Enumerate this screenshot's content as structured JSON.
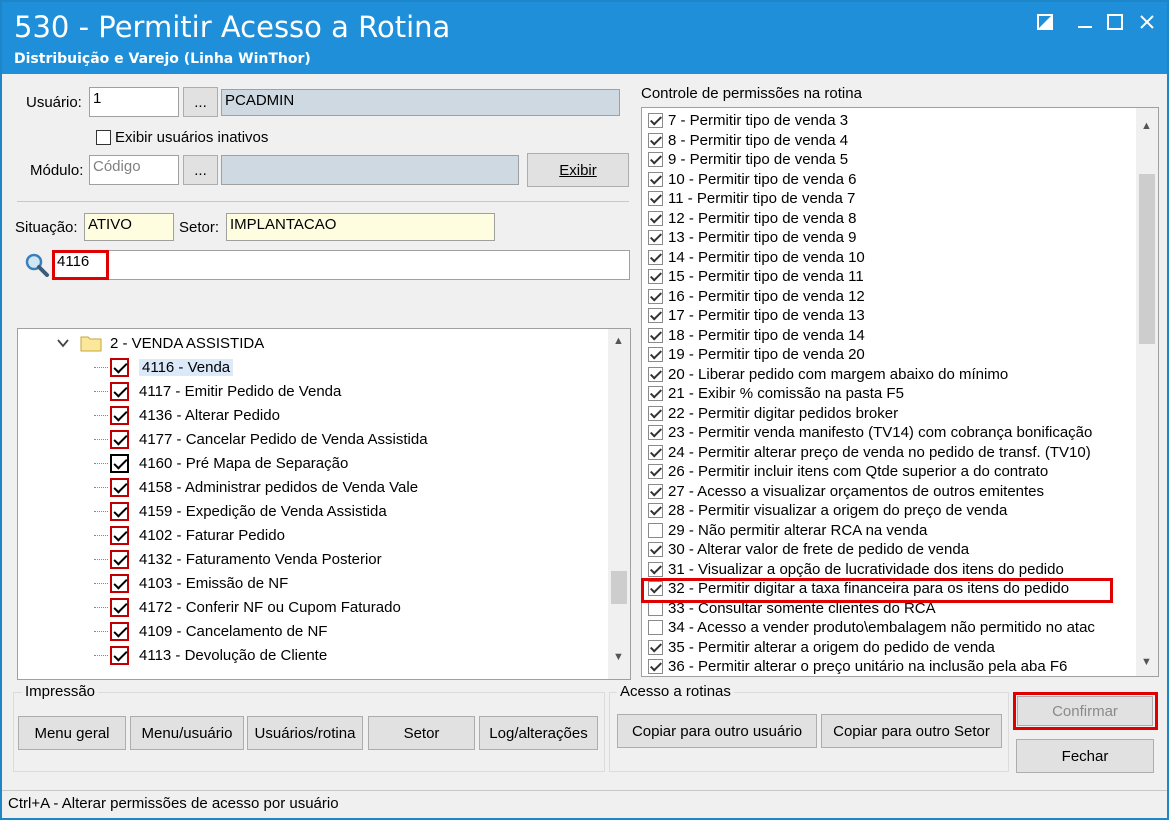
{
  "window": {
    "title": "530 - Permitir Acesso a Rotina",
    "subtitle": "Distribuição e Varejo (Linha WinThor)"
  },
  "user": {
    "label": "Usuário:",
    "code": "1",
    "browse": "...",
    "name": "PCADMIN",
    "show_inactive_label": "Exibir usuários inativos"
  },
  "module": {
    "label": "Módulo:",
    "placeholder": "Código",
    "browse": "...",
    "show_button": "Exibir"
  },
  "status": {
    "situacao_label": "Situação:",
    "situacao_value": "ATIVO",
    "setor_label": "Setor:",
    "setor_value": "IMPLANTACAO"
  },
  "search": {
    "icon": "search-icon",
    "value": "4116"
  },
  "tree": {
    "folder_label": "2 - VENDA ASSISTIDA",
    "items": [
      {
        "label": "4116 - Venda",
        "selected": true
      },
      {
        "label": "4117 - Emitir Pedido de Venda"
      },
      {
        "label": "4136 - Alterar Pedido"
      },
      {
        "label": "4177 - Cancelar Pedido de Venda Assistida"
      },
      {
        "label": "4160 - Pré Mapa de Separação"
      },
      {
        "label": "4158 - Administrar pedidos de Venda Vale"
      },
      {
        "label": "4159 - Expedição de Venda Assistida"
      },
      {
        "label": "4102 - Faturar Pedido"
      },
      {
        "label": "4132 - Faturamento Venda Posterior"
      },
      {
        "label": "4103 - Emissão de NF"
      },
      {
        "label": "4172 - Conferir NF ou Cupom Faturado"
      },
      {
        "label": "4109 - Cancelamento de NF"
      },
      {
        "label": "4113 - Devolução de Cliente"
      }
    ]
  },
  "permissions": {
    "header": "Controle de permissões na rotina",
    "items": [
      {
        "label": "7 - Permitir tipo de venda 3",
        "checked": true
      },
      {
        "label": "8 - Permitir tipo de venda 4",
        "checked": true
      },
      {
        "label": "9 - Permitir tipo de venda 5",
        "checked": true
      },
      {
        "label": "10 - Permitir tipo de venda 6",
        "checked": true
      },
      {
        "label": "11 - Permitir tipo de venda 7",
        "checked": true
      },
      {
        "label": "12 - Permitir tipo de venda 8",
        "checked": true
      },
      {
        "label": "13 - Permitir tipo de venda 9",
        "checked": true
      },
      {
        "label": "14 - Permitir tipo de venda 10",
        "checked": true
      },
      {
        "label": "15 - Permitir tipo de venda 11",
        "checked": true
      },
      {
        "label": "16 - Permitir tipo de venda 12",
        "checked": true
      },
      {
        "label": "17 - Permitir tipo de venda 13",
        "checked": true
      },
      {
        "label": "18 - Permitir tipo de venda 14",
        "checked": true
      },
      {
        "label": "19 - Permitir tipo de venda 20",
        "checked": true
      },
      {
        "label": "20 - Liberar pedido com margem abaixo do mínimo",
        "checked": true
      },
      {
        "label": "21 - Exibir % comissão na pasta F5",
        "checked": true
      },
      {
        "label": "22 - Permitir digitar pedidos broker",
        "checked": true
      },
      {
        "label": "23 - Permitir venda manifesto (TV14) com cobrança bonificação",
        "checked": true
      },
      {
        "label": "24 - Permitir alterar preço de venda no pedido de transf. (TV10)",
        "checked": true
      },
      {
        "label": "26 - Permitir incluir itens com Qtde superior a do contrato",
        "checked": true
      },
      {
        "label": "27 - Acesso a visualizar orçamentos de outros emitentes",
        "checked": true
      },
      {
        "label": "28 - Permitir visualizar a origem do preço de venda",
        "checked": true
      },
      {
        "label": "29 - Não permitir alterar RCA na venda",
        "checked": false
      },
      {
        "label": "30 - Alterar valor de frete de pedido de venda",
        "checked": true
      },
      {
        "label": "31 - Visualizar a opção de lucratividade dos itens do pedido",
        "checked": true
      },
      {
        "label": "32 - Permitir digitar a taxa financeira para os itens do pedido",
        "checked": true
      },
      {
        "label": "33 - Consultar somente clientes do RCA",
        "checked": false
      },
      {
        "label": "34 - Acesso a vender produto\\embalagem não permitido no atac",
        "checked": false
      },
      {
        "label": "35 - Permitir alterar a origem do pedido de venda",
        "checked": true
      },
      {
        "label": "36 - Permitir alterar o preço unitário na inclusão pela aba F6",
        "checked": true
      }
    ]
  },
  "impressao": {
    "title": "Impressão",
    "buttons": [
      "Menu geral",
      "Menu/usuário",
      "Usuários/rotina",
      "Setor",
      "Log/alterações"
    ]
  },
  "acesso": {
    "title": "Acesso a rotinas",
    "buttons": [
      "Copiar para outro usuário",
      "Copiar para outro Setor"
    ]
  },
  "actions": {
    "confirm": "Confirmar",
    "close": "Fechar"
  },
  "statusbar": "Ctrl+A - Alterar permissões de acesso por usuário"
}
